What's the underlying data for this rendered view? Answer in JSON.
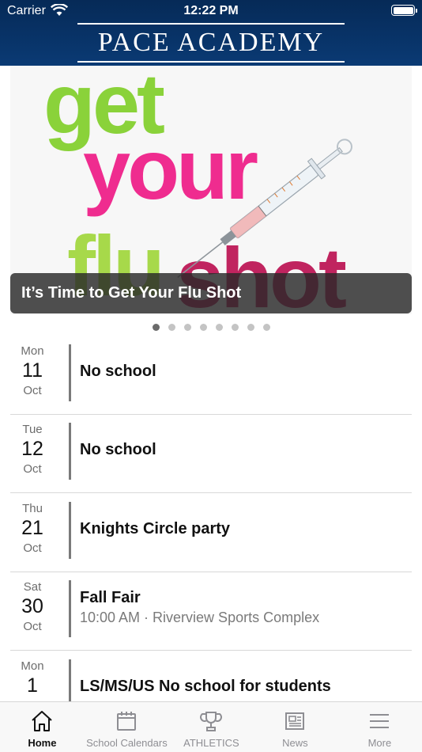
{
  "status_bar": {
    "carrier": "Carrier",
    "time": "12:22 PM"
  },
  "header": {
    "logo_text": "PACE ACADEMY"
  },
  "carousel": {
    "slide_caption": "It’s Time to Get Your Flu Shot",
    "slide_art_text": [
      "get",
      "your",
      "flu",
      "shot"
    ],
    "slide_count": 8,
    "active_index": 0
  },
  "events": [
    {
      "dow": "Mon",
      "day": "11",
      "month": "Oct",
      "title": "No school",
      "subtitle": ""
    },
    {
      "dow": "Tue",
      "day": "12",
      "month": "Oct",
      "title": "No school",
      "subtitle": ""
    },
    {
      "dow": "Thu",
      "day": "21",
      "month": "Oct",
      "title": "Knights Circle party",
      "subtitle": ""
    },
    {
      "dow": "Sat",
      "day": "30",
      "month": "Oct",
      "title": "Fall Fair",
      "subtitle": "10:00 AM · Riverview Sports Complex"
    },
    {
      "dow": "Mon",
      "day": "1",
      "month": "",
      "title": "LS/MS/US No school for students",
      "subtitle": ""
    }
  ],
  "tabs": [
    {
      "label": "Home",
      "icon": "home-icon",
      "active": true
    },
    {
      "label": "School Calendars",
      "icon": "calendar-icon",
      "active": false
    },
    {
      "label": "ATHLETICS",
      "icon": "trophy-icon",
      "active": false
    },
    {
      "label": "News",
      "icon": "newspaper-icon",
      "active": false
    },
    {
      "label": "More",
      "icon": "menu-icon",
      "active": false
    }
  ],
  "colors": {
    "header_bg": "#0a3a74",
    "active_tab": "#111111",
    "inactive_tab": "#8e8e93"
  }
}
